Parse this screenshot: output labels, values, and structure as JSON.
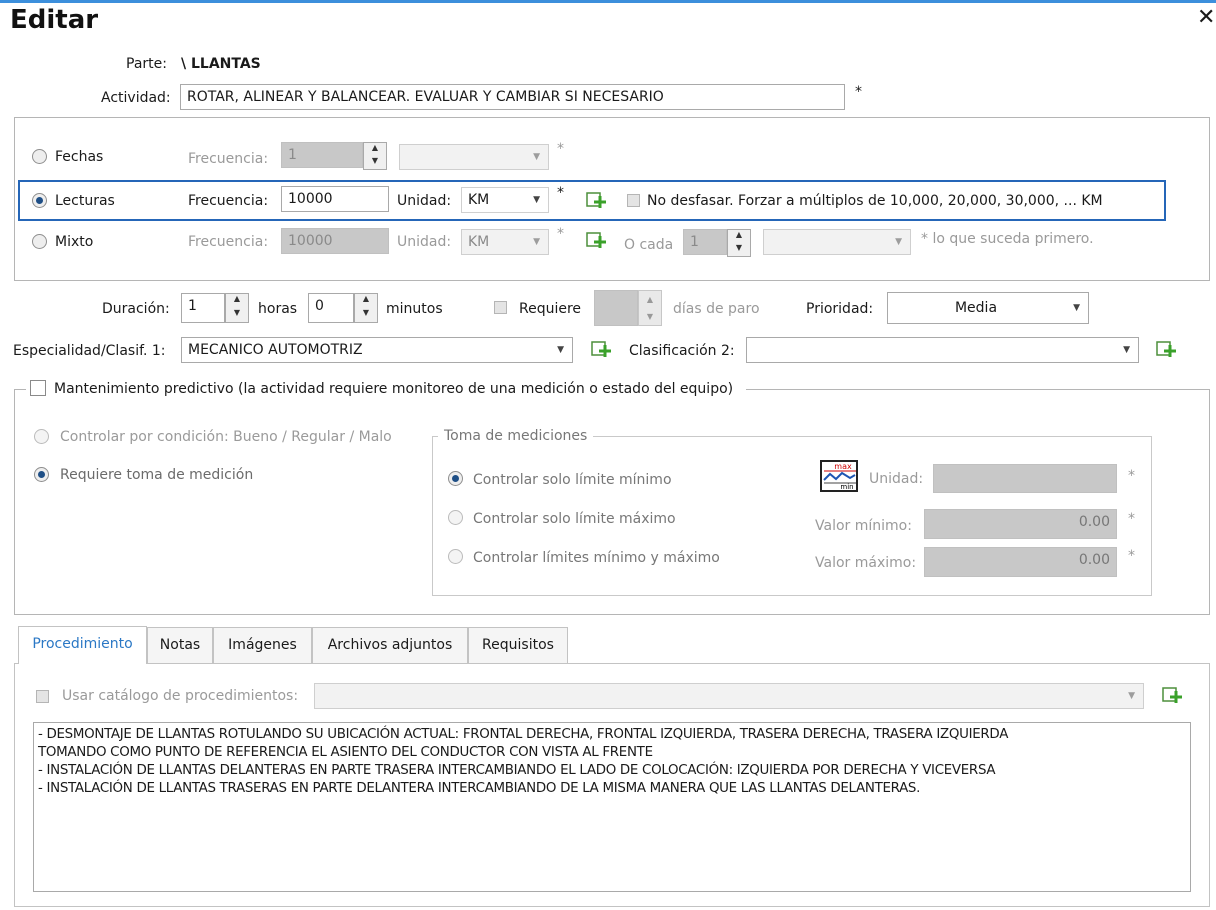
{
  "window": {
    "title": "Editar",
    "close": "✕"
  },
  "parte": {
    "label": "Parte:",
    "value": "\\ LLANTAS"
  },
  "actividad": {
    "label": "Actividad:",
    "value": "ROTAR, ALINEAR Y BALANCEAR. EVALUAR Y CAMBIAR SI NECESARIO"
  },
  "required": "*",
  "freq": {
    "fechas": {
      "label": "Fechas",
      "freq_label": "Frecuencia:",
      "value": "1"
    },
    "lecturas": {
      "label": "Lecturas",
      "freq_label": "Frecuencia:",
      "value": "10000",
      "unit_label": "Unidad:",
      "unit": "KM",
      "no_desfasar": "No desfasar. Forzar a múltiplos de 10,000, 20,000, 30,000, ... KM"
    },
    "mixto": {
      "label": "Mixto",
      "freq_label": "Frecuencia:",
      "value": "10000",
      "unit_label": "Unidad:",
      "unit": "KM",
      "o_cada": "O cada",
      "o_cada_value": "1",
      "note": "* lo que suceda primero."
    }
  },
  "duracion": {
    "label": "Duración:",
    "horas": "1",
    "horas_label": "horas",
    "minutos": "0",
    "minutos_label": "minutos",
    "requiere": "Requiere",
    "dias": "días de paro",
    "prioridad_label": "Prioridad:",
    "prioridad": "Media"
  },
  "especialidad": {
    "label": "Especialidad/Clasif. 1:",
    "value": "MECANICO AUTOMOTRIZ",
    "clasif2_label": "Clasificación 2:",
    "clasif2_value": ""
  },
  "predictivo": {
    "label": "Mantenimiento predictivo (la actividad requiere monitoreo de una medición o estado del equipo)",
    "condicion": "Controlar por condición: Bueno / Regular / Malo",
    "requiere_toma": "Requiere toma de medición",
    "toma": {
      "title": "Toma de mediciones",
      "solo_min": "Controlar solo límite mínimo",
      "solo_max": "Controlar solo límite máximo",
      "min_max": "Controlar límites mínimo y máximo",
      "unidad_label": "Unidad:",
      "unidad": "",
      "valor_min_label": "Valor mínimo:",
      "valor_min": "0.00",
      "valor_max_label": "Valor máximo:",
      "valor_max": "0.00",
      "icon_top": "max",
      "icon_bottom": "min"
    }
  },
  "tabs": [
    "Procedimiento",
    "Notas",
    "Imágenes",
    "Archivos adjuntos",
    "Requisitos"
  ],
  "procedimiento": {
    "usar_catalogo": "Usar catálogo de procedimientos:",
    "lines": [
      "- DESMONTAJE DE LLANTAS ROTULANDO SU UBICACIÓN ACTUAL: FRONTAL DERECHA, FRONTAL IZQUIERDA, TRASERA DERECHA, TRASERA IZQUIERDA",
      "TOMANDO COMO PUNTO DE REFERENCIA EL ASIENTO DEL CONDUCTOR CON VISTA AL FRENTE",
      "- INSTALACIÓN DE LLANTAS DELANTERAS EN PARTE TRASERA INTERCAMBIANDO EL LADO DE COLOCACIÓN: IZQUIERDA POR DERECHA Y VICEVERSA",
      "- INSTALACIÓN DE LLANTAS TRASERAS EN PARTE DELANTERA INTERCAMBIANDO DE LA MISMA MANERA QUE LAS LLANTAS DELANTERAS."
    ]
  }
}
